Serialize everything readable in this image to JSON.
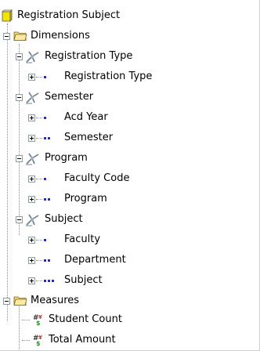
{
  "tree": {
    "root": {
      "label": "Registration Subject",
      "icon": "cube-icon"
    },
    "dimensions": {
      "label": "Dimensions",
      "icon": "folder-open-icon",
      "items": [
        {
          "label": "Registration Type",
          "levels": [
            {
              "label": "Registration Type",
              "dots": 1
            }
          ]
        },
        {
          "label": "Semester",
          "levels": [
            {
              "label": "Acd Year",
              "dots": 1
            },
            {
              "label": "Semester",
              "dots": 2
            }
          ]
        },
        {
          "label": "Program",
          "levels": [
            {
              "label": "Faculty Code",
              "dots": 1
            },
            {
              "label": "Program",
              "dots": 2
            }
          ]
        },
        {
          "label": "Subject",
          "levels": [
            {
              "label": "Faculty",
              "dots": 1
            },
            {
              "label": "Department",
              "dots": 2
            },
            {
              "label": "Subject",
              "dots": 3
            }
          ]
        }
      ]
    },
    "measures": {
      "label": "Measures",
      "icon": "folder-open-icon",
      "items": [
        {
          "label": "Student Count"
        },
        {
          "label": "Total Amount"
        }
      ]
    }
  },
  "colors": {
    "level_dot": "#1e2ad6",
    "cube": "#f2e400",
    "folder": "#f3d976"
  }
}
